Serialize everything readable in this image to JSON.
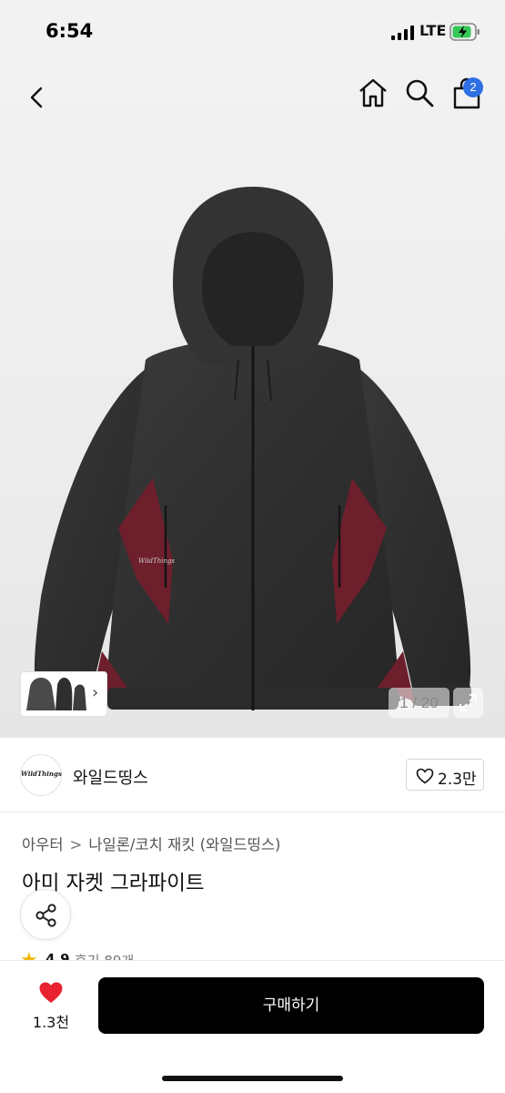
{
  "status_bar": {
    "time": "6:54",
    "network": "LTE"
  },
  "nav": {
    "cart_count": "2"
  },
  "gallery": {
    "counter": "1 / 20",
    "thumb_arrow": "›"
  },
  "brand": {
    "logo_text": "WildThings",
    "name": "와일드띵스",
    "like_count": "2.3만"
  },
  "breadcrumb": {
    "level1": "아우터",
    "separator": ">",
    "level2": "나일론/코치 재킷 (와일드띵스)"
  },
  "product": {
    "title": "아미 자켓 그라파이트",
    "rating": "4.9",
    "review_text": "후기 89개"
  },
  "bottom_bar": {
    "wish_count": "1.3천",
    "buy_label": "구매하기"
  },
  "colors": {
    "accent_blue": "#2f6fe4",
    "heart_red": "#e8222f",
    "star_yellow": "#f0b90b",
    "buy_bg": "#000000"
  }
}
